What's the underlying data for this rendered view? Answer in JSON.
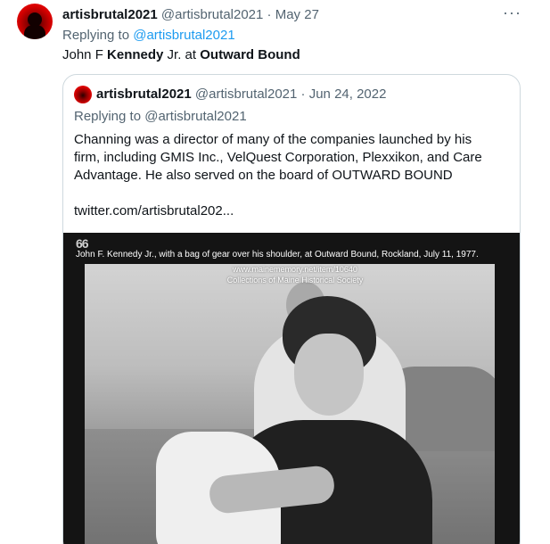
{
  "tweet": {
    "name": "artisbrutal2021",
    "handle": "@artisbrutal2021",
    "separator": "·",
    "date": "May 27",
    "more_label": "···",
    "replying_prefix": "Replying to ",
    "replying_to": "@artisbrutal2021",
    "text_parts": [
      "John F ",
      "Kennedy",
      " Jr. at ",
      "Outward Bound"
    ]
  },
  "quoted": {
    "name": "artisbrutal2021",
    "handle": "@artisbrutal2021",
    "separator": "·",
    "date": "Jun 24, 2022",
    "replying_text": "Replying to @artisbrutal2021",
    "lines": [
      "Channing was a director of many of the companies launched by his",
      "firm, including GMIS Inc., VelQuest Corporation, Plexxikon, and Care",
      "Advantage. He also served on the board of OUTWARD BOUND"
    ],
    "link": "twitter.com/artisbrutal202...",
    "media": {
      "quote_mark": "66",
      "caption": "John F. Kennedy Jr., with a bag of gear over his shoulder, at Outward Bound, Rockland, July 11, 1977.",
      "watermark_url": "www.mainememory.net/item/10640",
      "watermark_credit": "Collections of Maine Historical Society"
    }
  },
  "colors": {
    "link": "#1d9bf0",
    "secondary_text": "#536471",
    "border": "#cfd9de",
    "avatar": "#d40000"
  }
}
